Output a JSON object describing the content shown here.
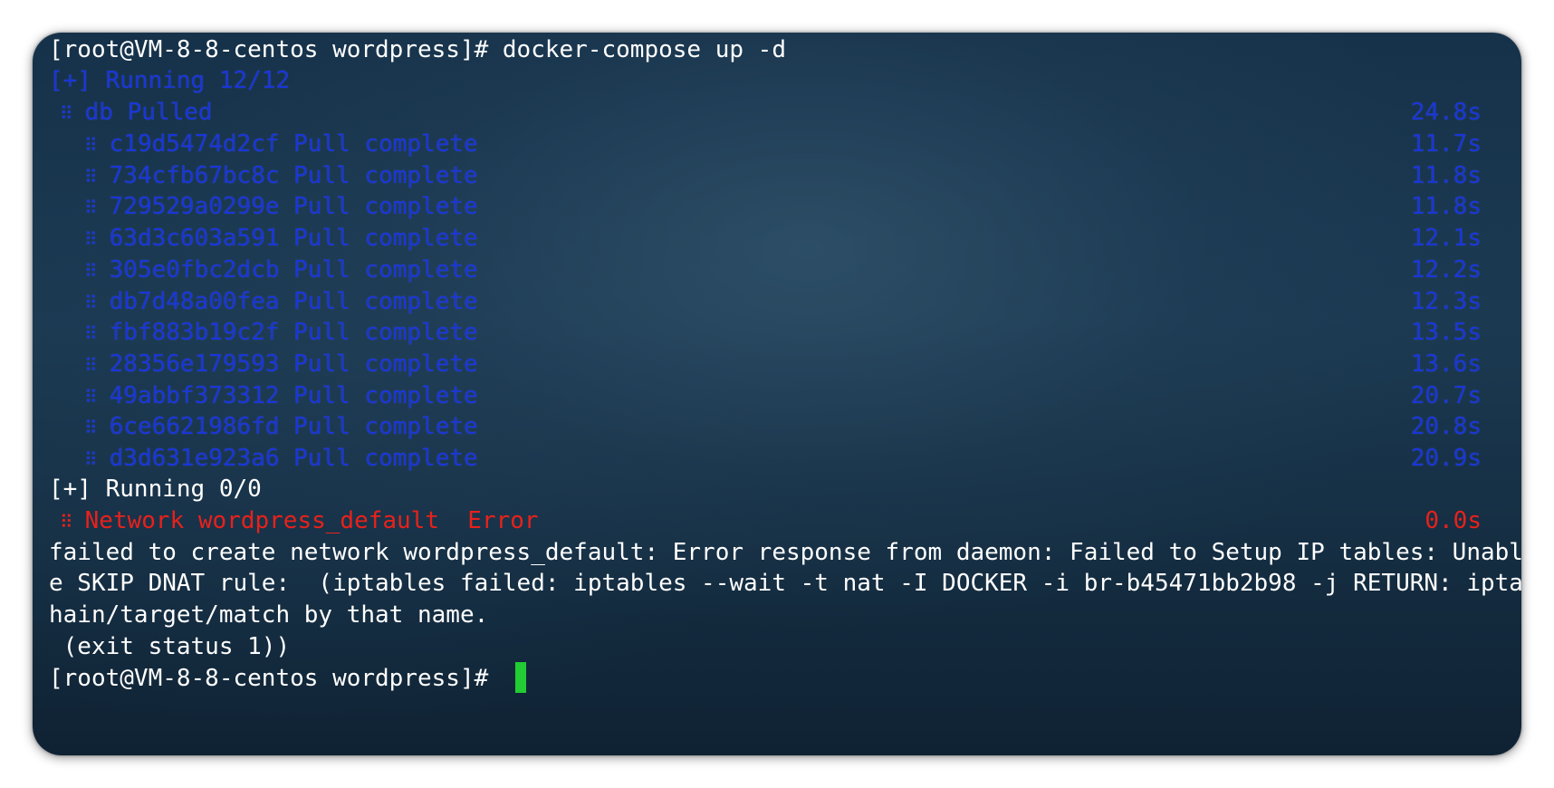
{
  "terminal": {
    "prompt_line": "[root@VM-8-8-centos wordpress]# docker-compose up -d",
    "running_1": "[+] Running 12/12",
    "db_line": {
      "dots": "⠿",
      "label": "db Pulled",
      "time": "24.8s"
    },
    "layers": [
      {
        "dots": "⠿",
        "id": "c19d5474d2cf",
        "status": "Pull complete",
        "time": "11.7s"
      },
      {
        "dots": "⠿",
        "id": "734cfb67bc8c",
        "status": "Pull complete",
        "time": "11.8s"
      },
      {
        "dots": "⠿",
        "id": "729529a0299e",
        "status": "Pull complete",
        "time": "11.8s"
      },
      {
        "dots": "⠿",
        "id": "63d3c603a591",
        "status": "Pull complete",
        "time": "12.1s"
      },
      {
        "dots": "⠿",
        "id": "305e0fbc2dcb",
        "status": "Pull complete",
        "time": "12.2s"
      },
      {
        "dots": "⠿",
        "id": "db7d48a00fea",
        "status": "Pull complete",
        "time": "12.3s"
      },
      {
        "dots": "⠿",
        "id": "fbf883b19c2f",
        "status": "Pull complete",
        "time": "13.5s"
      },
      {
        "dots": "⠿",
        "id": "28356e179593",
        "status": "Pull complete",
        "time": "13.6s"
      },
      {
        "dots": "⠿",
        "id": "49abbf373312",
        "status": "Pull complete",
        "time": "20.7s"
      },
      {
        "dots": "⠿",
        "id": "6ce6621986fd",
        "status": "Pull complete",
        "time": "20.8s"
      },
      {
        "dots": "⠿",
        "id": "d3d631e923a6",
        "status": "Pull complete",
        "time": "20.9s"
      }
    ],
    "running_2": "[+] Running 0/0",
    "error_line": {
      "dots": "⠿",
      "label": "Network wordpress_default  Error",
      "time": "0.0s"
    },
    "error_text": [
      "failed to create network wordpress_default: Error response from daemon: Failed to Setup IP tables: Unable to enabl",
      "e SKIP DNAT rule:  (iptables failed: iptables --wait -t nat -I DOCKER -i br-b45471bb2b98 -j RETURN: iptables: No c",
      "hain/target/match by that name.",
      " (exit status 1))"
    ],
    "final_prompt": "[root@VM-8-8-centos wordpress]# ",
    "cursor_color": "#22cc33"
  }
}
